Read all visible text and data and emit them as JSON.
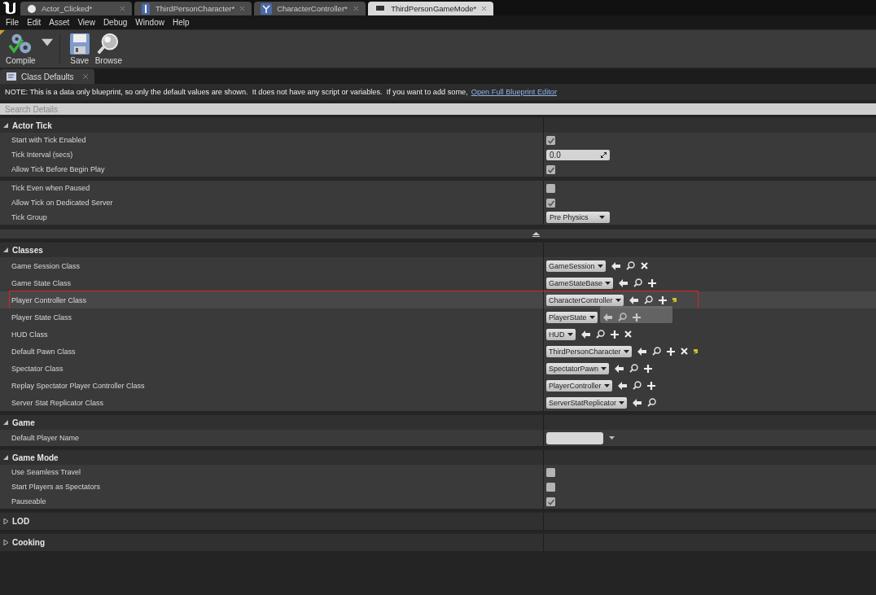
{
  "editor_tabs": [
    {
      "label": "Actor_Clicked*",
      "kind": "sphere",
      "selected": false
    },
    {
      "label": "ThirdPersonCharacter*",
      "kind": "pawn",
      "selected": false
    },
    {
      "label": "CharacterController*",
      "kind": "controller",
      "selected": false
    },
    {
      "label": "ThirdPersonGameMode*",
      "kind": "gamemode",
      "selected": true
    }
  ],
  "menu": [
    "File",
    "Edit",
    "Asset",
    "View",
    "Debug",
    "Window",
    "Help"
  ],
  "toolbar": [
    {
      "label": "Compile",
      "kind": "compile",
      "has_dropdown": true
    },
    {
      "label": "Save",
      "kind": "save",
      "has_dropdown": false
    },
    {
      "label": "Browse",
      "kind": "browse",
      "has_dropdown": false
    }
  ],
  "panel_tab": {
    "label": "Class Defaults"
  },
  "notice": {
    "text": "NOTE: This is a data only blueprint, so only the default values are shown.  It does not have any script or variables.  If you want to add some,",
    "link": "Open Full Blueprint Editor"
  },
  "search": {
    "placeholder": "Search Details"
  },
  "sections": [
    {
      "title": "Actor Tick",
      "expanded": true,
      "advanced_toggle": true,
      "groups": [
        [
          {
            "label": "Start with Tick Enabled",
            "kind": "checkbox",
            "checked": true
          },
          {
            "label": "Tick Interval (secs)",
            "kind": "number",
            "value": "0.0"
          },
          {
            "label": "Allow Tick Before Begin Play",
            "kind": "checkbox",
            "checked": true
          }
        ],
        [
          {
            "label": "Tick Even when Paused",
            "kind": "checkbox",
            "checked": false
          },
          {
            "label": "Allow Tick on Dedicated Server",
            "kind": "checkbox",
            "checked": true
          },
          {
            "label": "Tick Group",
            "kind": "dropdown",
            "value": "Pre Physics"
          }
        ]
      ]
    },
    {
      "title": "Classes",
      "expanded": true,
      "advanced_toggle": false,
      "groups": [
        [
          {
            "label": "Game Session Class",
            "kind": "class",
            "value": "GameSession",
            "buttons": [
              {
                "kind": "use"
              },
              {
                "kind": "browse"
              },
              {
                "kind": "clear"
              }
            ],
            "highlighted": false
          },
          {
            "label": "Game State Class",
            "kind": "class",
            "value": "GameStateBase",
            "buttons": [
              {
                "kind": "use"
              },
              {
                "kind": "browse"
              },
              {
                "kind": "add"
              }
            ],
            "highlighted": false
          },
          {
            "label": "Player Controller Class",
            "kind": "class",
            "value": "CharacterController",
            "buttons": [
              {
                "kind": "use"
              },
              {
                "kind": "browse"
              },
              {
                "kind": "add"
              },
              {
                "kind": "reset"
              }
            ],
            "highlighted": true,
            "annotated": true
          },
          {
            "label": "Player State Class",
            "kind": "class",
            "value": "PlayerState",
            "buttons": [
              {
                "kind": "use"
              },
              {
                "kind": "browse"
              },
              {
                "kind": "add"
              }
            ],
            "highlighted": false,
            "drag_preview": true
          },
          {
            "label": "HUD Class",
            "kind": "class",
            "value": "HUD",
            "buttons": [
              {
                "kind": "use"
              },
              {
                "kind": "browse"
              },
              {
                "kind": "add"
              },
              {
                "kind": "clear"
              }
            ],
            "highlighted": false
          },
          {
            "label": "Default Pawn Class",
            "kind": "class",
            "value": "ThirdPersonCharacter",
            "buttons": [
              {
                "kind": "use"
              },
              {
                "kind": "browse"
              },
              {
                "kind": "add"
              },
              {
                "kind": "clear"
              },
              {
                "kind": "reset"
              }
            ],
            "highlighted": false
          },
          {
            "label": "Spectator Class",
            "kind": "class",
            "value": "SpectatorPawn",
            "buttons": [
              {
                "kind": "use"
              },
              {
                "kind": "browse"
              },
              {
                "kind": "add"
              }
            ],
            "highlighted": false
          },
          {
            "label": "Replay Spectator Player Controller Class",
            "kind": "class",
            "value": "PlayerController",
            "buttons": [
              {
                "kind": "use"
              },
              {
                "kind": "browse"
              },
              {
                "kind": "add"
              }
            ],
            "highlighted": false
          },
          {
            "label": "Server Stat Replicator Class",
            "kind": "class",
            "value": "ServerStatReplicator",
            "buttons": [
              {
                "kind": "use"
              },
              {
                "kind": "browse"
              }
            ],
            "highlighted": false
          }
        ]
      ]
    },
    {
      "title": "Game",
      "expanded": true,
      "advanced_toggle": false,
      "groups": [
        [
          {
            "label": "Default Player Name",
            "kind": "text"
          }
        ]
      ]
    },
    {
      "title": "Game Mode",
      "expanded": true,
      "advanced_toggle": false,
      "groups": [
        [
          {
            "label": "Use Seamless Travel",
            "kind": "checkbox",
            "checked": false
          },
          {
            "label": "Start Players as Spectators",
            "kind": "checkbox",
            "checked": false
          },
          {
            "label": "Pauseable",
            "kind": "checkbox",
            "checked": true
          }
        ]
      ]
    },
    {
      "title": "LOD",
      "expanded": false,
      "advanced_toggle": false
    },
    {
      "title": "Cooking",
      "expanded": false,
      "advanced_toggle": false
    }
  ]
}
